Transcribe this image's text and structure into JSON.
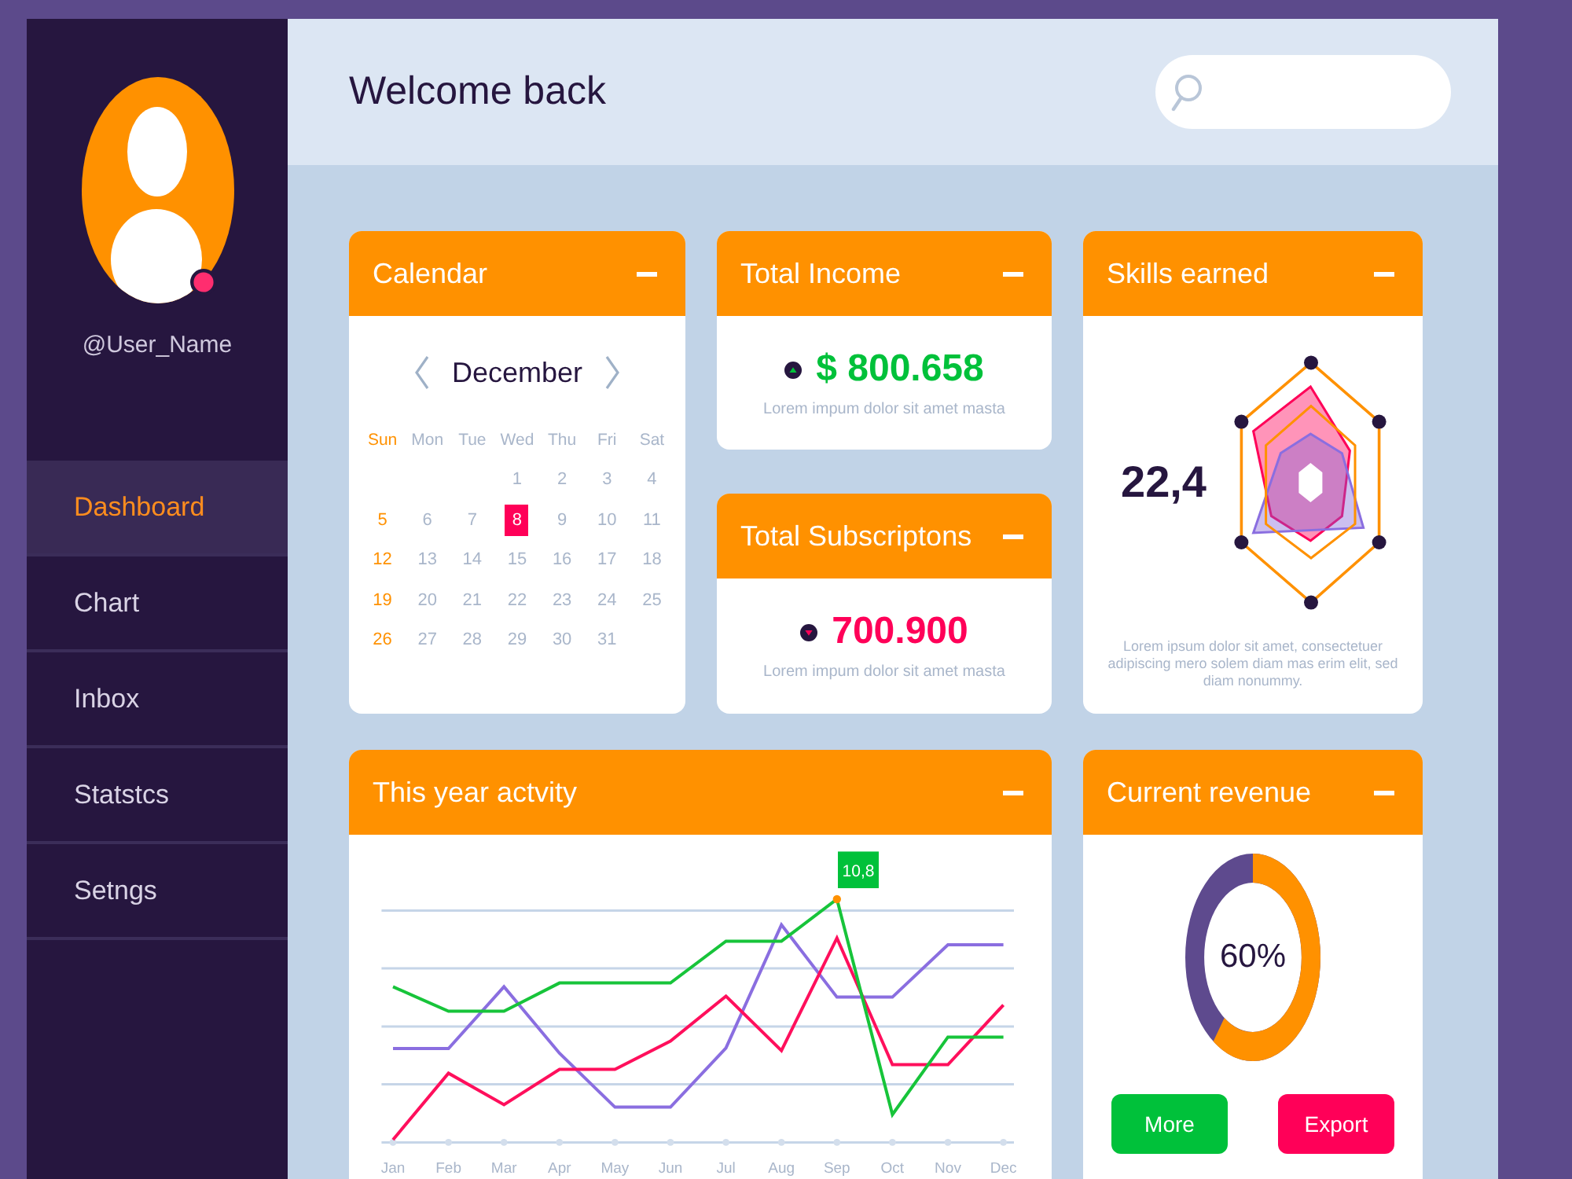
{
  "sidebar": {
    "user_name": "@User_Name",
    "nav_items": [
      {
        "label": "Dashboard",
        "selected": true
      },
      {
        "label": "Chart",
        "selected": false
      },
      {
        "label": "Inbox",
        "selected": false
      },
      {
        "label": "Statstcs",
        "selected": false
      },
      {
        "label": "Setngs",
        "selected": false
      }
    ]
  },
  "header": {
    "title": "Welcome back"
  },
  "calendar": {
    "title": "Calendar",
    "month": "December",
    "weekdays": [
      {
        "label": "Sun",
        "highlighted": true
      },
      {
        "label": "Mon",
        "highlighted": false
      },
      {
        "label": "Tue",
        "highlighted": false
      },
      {
        "label": "Wed",
        "highlighted": false
      },
      {
        "label": "Thu",
        "highlighted": false
      },
      {
        "label": "Fri",
        "highlighted": false
      },
      {
        "label": "Sat",
        "highlighted": false
      }
    ],
    "weeks": [
      [
        {
          "label": "1",
          "selected": false
        },
        {
          "label": "2",
          "selected": false
        },
        {
          "label": "3",
          "selected": false
        },
        {
          "label": "4",
          "selected": false
        }
      ],
      [
        {
          "label": "5",
          "selected": false
        },
        {
          "label": "6",
          "selected": false
        },
        {
          "label": "7",
          "selected": false
        },
        {
          "label": "8",
          "selected": true
        },
        {
          "label": "9",
          "selected": false
        },
        {
          "label": "10",
          "selected": false
        },
        {
          "label": "11",
          "selected": false
        }
      ],
      [
        {
          "label": "12",
          "selected": false
        },
        {
          "label": "13",
          "selected": false
        },
        {
          "label": "14",
          "selected": false
        },
        {
          "label": "15",
          "selected": false
        },
        {
          "label": "16",
          "selected": false
        },
        {
          "label": "17",
          "selected": false
        },
        {
          "label": "18",
          "selected": false
        }
      ],
      [
        {
          "label": "19",
          "selected": false
        },
        {
          "label": "20",
          "selected": false
        },
        {
          "label": "21",
          "selected": false
        },
        {
          "label": "22",
          "selected": false
        },
        {
          "label": "23",
          "selected": false
        },
        {
          "label": "24",
          "selected": false
        },
        {
          "label": "25",
          "selected": false
        }
      ],
      [
        {
          "label": "26",
          "selected": false
        },
        {
          "label": "27",
          "selected": false
        },
        {
          "label": "28",
          "selected": false
        },
        {
          "label": "29",
          "selected": false
        },
        {
          "label": "30",
          "selected": false
        },
        {
          "label": "31",
          "selected": false
        }
      ]
    ]
  },
  "stats": [
    {
      "title": "Total Income",
      "kind": "up",
      "value": "$ 800.658",
      "caption": "Lorem impum dolor sit amet masta"
    },
    {
      "title": "Total Subscriptons",
      "kind": "down",
      "value": "700.900",
      "caption": "Lorem impum dolor sit amet masta"
    }
  ],
  "skills": {
    "title": "Skills earned",
    "value": "22,4",
    "caption": "Lorem ipsum dolor sit amet, consectetuer adipiscing mero solem diam mas erim elit, sed diam nonummy."
  },
  "activity": {
    "title": "This year actvity",
    "months": [
      "Jan",
      "Feb",
      "Mar",
      "Apr",
      "May",
      "Jun",
      "Jul",
      "Aug",
      "Sep",
      "Oct",
      "Nov",
      "Dec"
    ],
    "callout": "10,8"
  },
  "revenue": {
    "title": "Current revenue",
    "level": 0.6,
    "reading": "60%",
    "buttons": [
      {
        "label": "More",
        "kind": "primary"
      },
      {
        "label": "Export",
        "kind": "danger"
      }
    ]
  }
}
